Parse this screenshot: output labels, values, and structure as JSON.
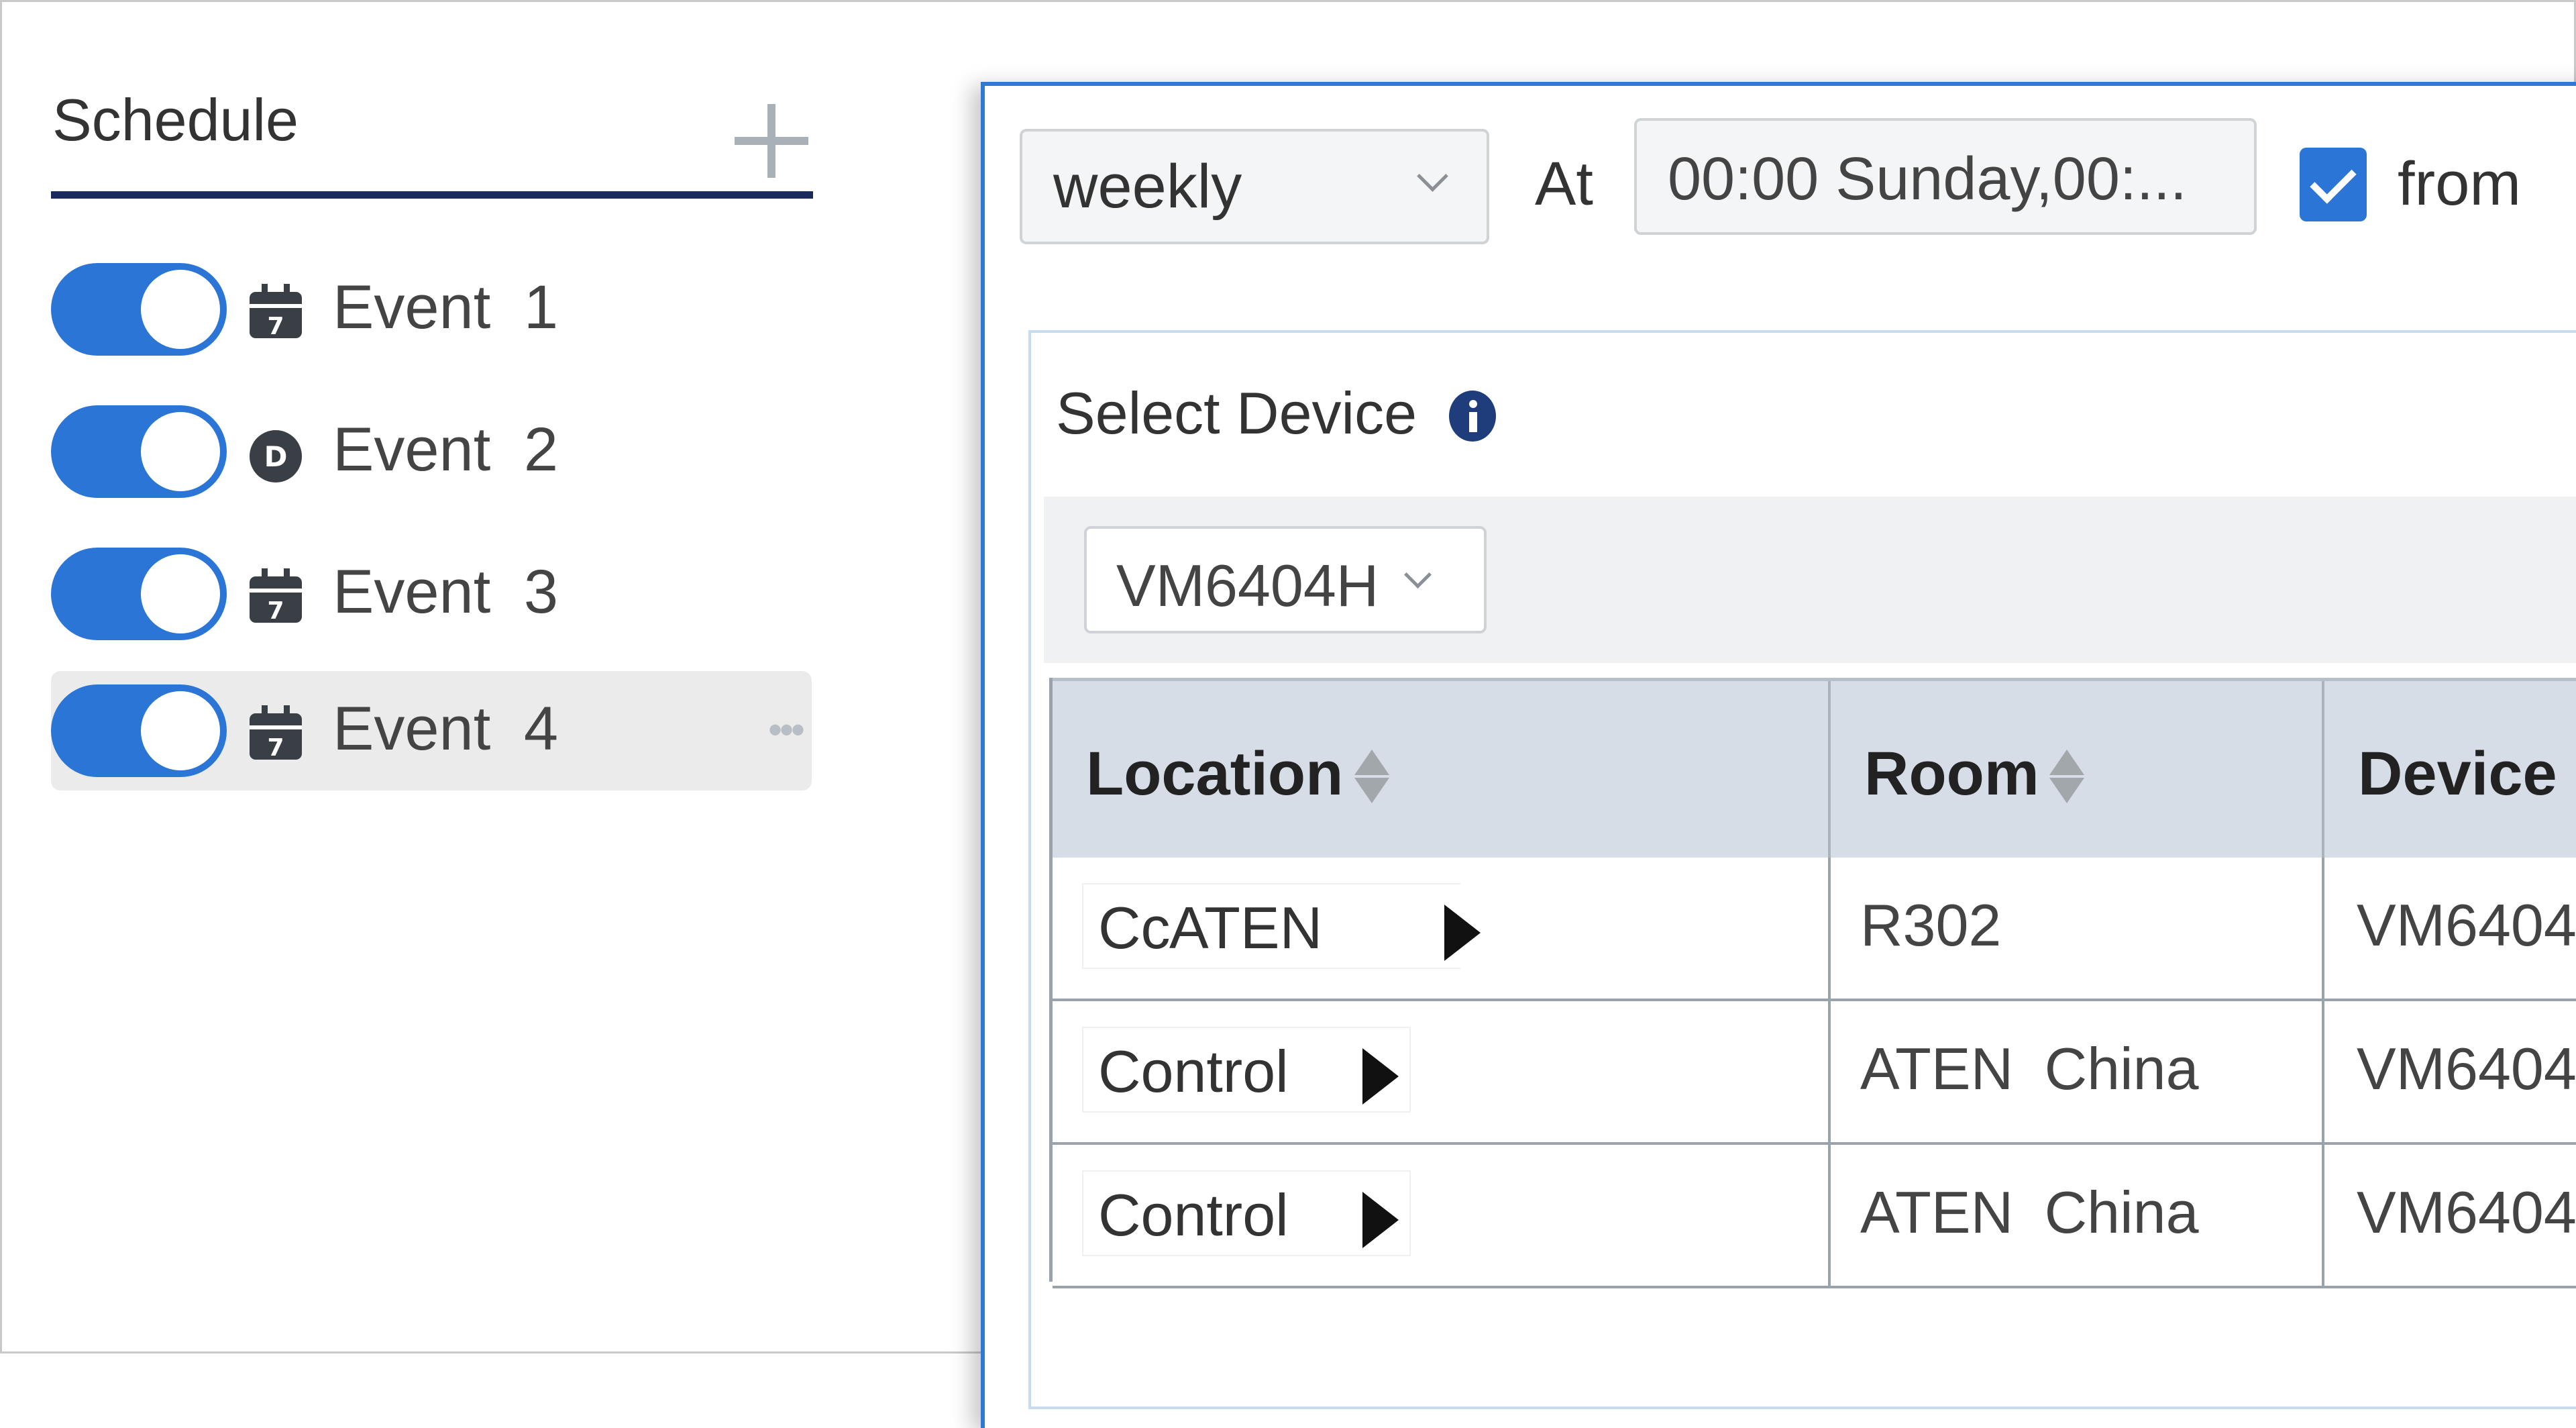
{
  "schedule": {
    "title": "Schedule",
    "add_icon": "plus-icon",
    "events": [
      {
        "label": "Event 1",
        "icon": "calendar-7-icon",
        "enabled": true,
        "selected": false
      },
      {
        "label": "Event 2",
        "icon": "d-circle-icon",
        "enabled": true,
        "selected": false
      },
      {
        "label": "Event 3",
        "icon": "calendar-7-icon",
        "enabled": true,
        "selected": false
      },
      {
        "label": "Event 4",
        "icon": "calendar-7-icon",
        "enabled": true,
        "selected": true,
        "more_icon": "ellipsis-icon"
      }
    ]
  },
  "dialog": {
    "frequency": {
      "value": "weekly"
    },
    "at_label": "At",
    "time_value": "00:00 Sunday,00:...",
    "from": {
      "checked": true,
      "label": "from"
    },
    "select_device": {
      "label": "Select Device",
      "info_icon": "info-icon"
    },
    "device_filter": {
      "value": "VM6404H"
    },
    "table": {
      "columns": [
        "Location",
        "Room",
        "Device"
      ],
      "rows": [
        {
          "location": "Cc",
          "location_overlay": "ATEN",
          "room": "R302",
          "device": "VM6404"
        },
        {
          "location": "Control",
          "room": "ATEN China",
          "device": "VM6404"
        },
        {
          "location": "Control",
          "room": "ATEN China",
          "device": "VM6404"
        }
      ]
    }
  },
  "colors": {
    "accent": "#2b75d6",
    "underline": "#1b2a5c",
    "header_bg": "#d6dde6",
    "dialog_border": "#2d7ad3"
  }
}
